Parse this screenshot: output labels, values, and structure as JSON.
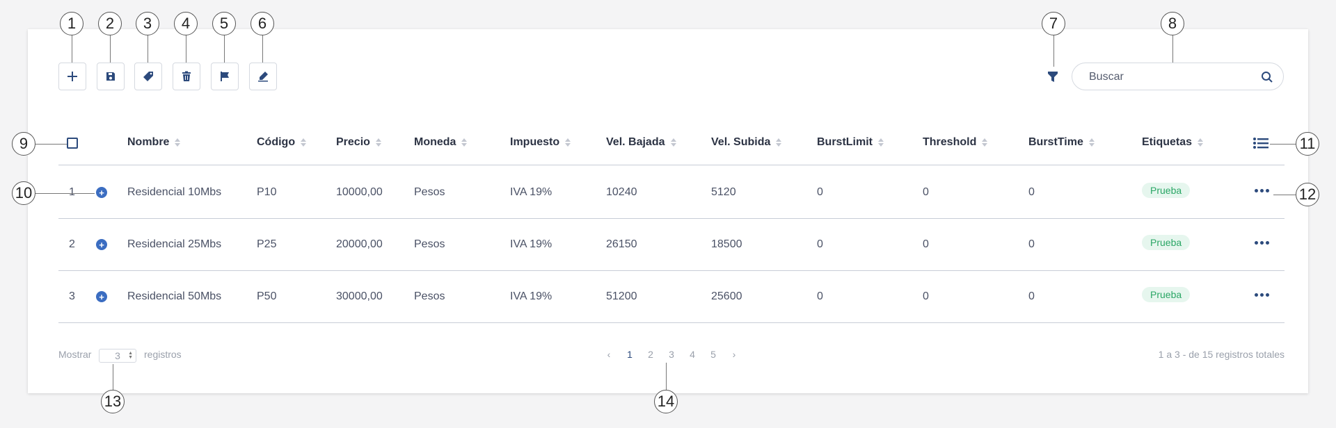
{
  "toolbar": {
    "buttons": [
      {
        "name": "add-button",
        "icon": "plus-icon"
      },
      {
        "name": "save-button",
        "icon": "floppy-disk-icon"
      },
      {
        "name": "tag-button",
        "icon": "tag-icon"
      },
      {
        "name": "delete-button",
        "icon": "trash-icon"
      },
      {
        "name": "flag-button",
        "icon": "flag-icon"
      },
      {
        "name": "edit-button",
        "icon": "pencil-icon"
      }
    ],
    "filter_icon": "funnel-icon"
  },
  "search": {
    "placeholder": "Buscar",
    "icon": "search-icon"
  },
  "table": {
    "columns": [
      "Nombre",
      "Código",
      "Precio",
      "Moneda",
      "Impuesto",
      "Vel. Bajada",
      "Vel. Subida",
      "BurstLimit",
      "Threshold",
      "BurstTime",
      "Etiquetas"
    ],
    "rows": [
      {
        "index": "1",
        "nombre": "Residencial 10Mbs",
        "codigo": "P10",
        "precio": "10000,00",
        "moneda": "Pesos",
        "impuesto": "IVA 19%",
        "bajada": "10240",
        "subida": "5120",
        "burstlimit": "0",
        "threshold": "0",
        "bursttime": "0",
        "etiqueta": "Prueba"
      },
      {
        "index": "2",
        "nombre": "Residencial 25Mbs",
        "codigo": "P25",
        "precio": "20000,00",
        "moneda": "Pesos",
        "impuesto": "IVA 19%",
        "bajada": "26150",
        "subida": "18500",
        "burstlimit": "0",
        "threshold": "0",
        "bursttime": "0",
        "etiqueta": "Prueba"
      },
      {
        "index": "3",
        "nombre": "Residencial 50Mbs",
        "codigo": "P50",
        "precio": "30000,00",
        "moneda": "Pesos",
        "impuesto": "IVA 19%",
        "bajada": "51200",
        "subida": "25600",
        "burstlimit": "0",
        "threshold": "0",
        "bursttime": "0",
        "etiqueta": "Prueba"
      }
    ]
  },
  "footer": {
    "show_label": "Mostrar",
    "per_page": "3",
    "records_label": "registros",
    "pages": [
      "1",
      "2",
      "3",
      "4",
      "5"
    ],
    "active_page": "1",
    "prev": "‹",
    "next": "›",
    "summary": "1 a 3 - de 15 registros totales"
  },
  "callouts": [
    "1",
    "2",
    "3",
    "4",
    "5",
    "6",
    "7",
    "8",
    "9",
    "10",
    "11",
    "12",
    "13",
    "14"
  ],
  "colors": {
    "primary": "#2c4a7c",
    "accent": "#3b6dc1",
    "tag_bg": "#e6f6ee",
    "tag_text": "#2aa665"
  }
}
